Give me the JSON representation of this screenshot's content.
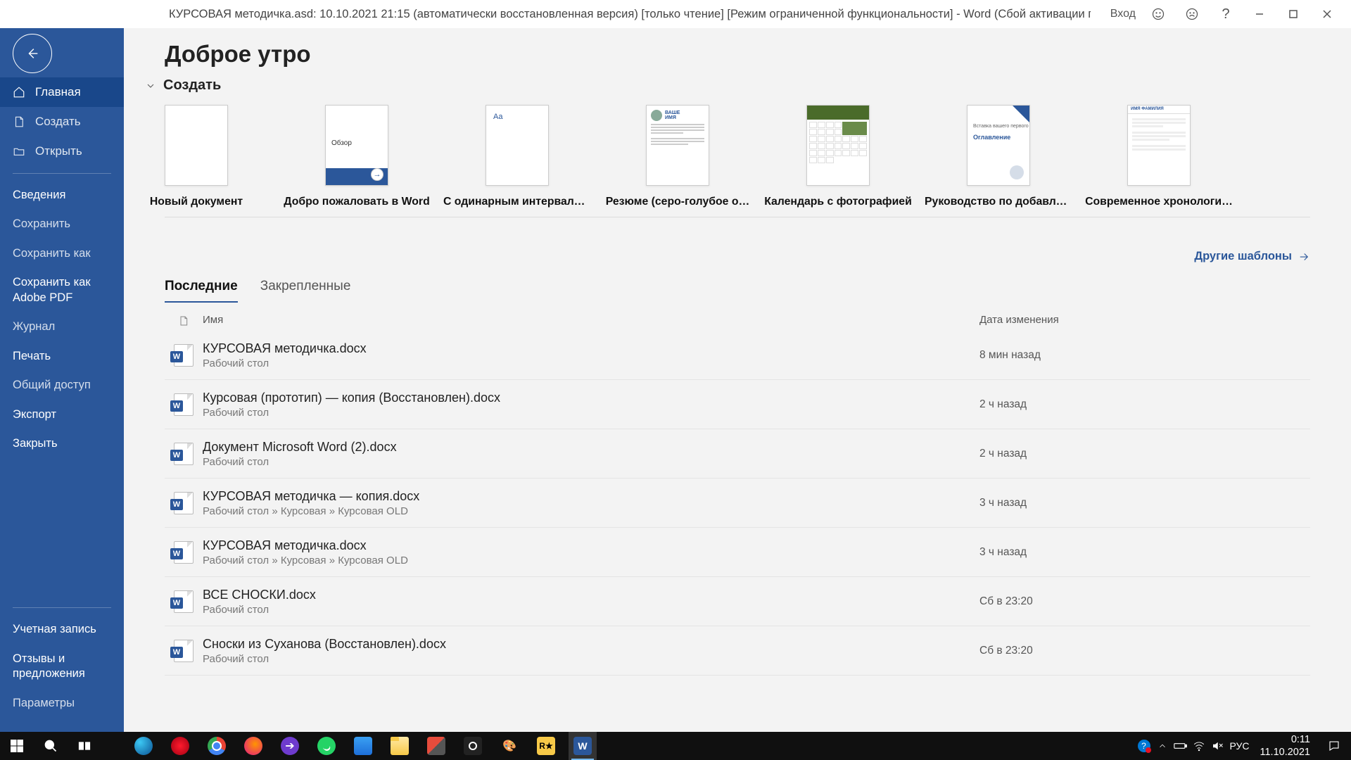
{
  "titlebar": {
    "text": "КУРСОВАЯ методичка.asd: 10.10.2021 21:15 (автоматически восстановленная версия) [только чтение] [Режим ограниченной функциональности]  -  Word (Сбой активации продукта)",
    "login": "Вход"
  },
  "sidebar": {
    "home": "Главная",
    "create": "Создать",
    "open": "Открыть",
    "info": "Сведения",
    "save": "Сохранить",
    "save_as": "Сохранить как",
    "save_pdf": "Сохранить как Adobe PDF",
    "history": "Журнал",
    "print": "Печать",
    "share": "Общий доступ",
    "export": "Экспорт",
    "close": "Закрыть",
    "account": "Учетная запись",
    "feedback": "Отзывы и предложения",
    "options": "Параметры"
  },
  "main": {
    "greeting": "Доброе утро",
    "create_section": "Создать",
    "templates": [
      {
        "label": "Новый документ"
      },
      {
        "label": "Добро пожаловать в Word"
      },
      {
        "label": "С одинарным интервало…"
      },
      {
        "label": "Резюме (серо-голубое о…"
      },
      {
        "label": "Календарь с фотографией"
      },
      {
        "label": "Руководство по добавле…"
      },
      {
        "label": "Современное хронологи…"
      }
    ],
    "tour_text": "Обзор",
    "guide_t1": "Вставка вашего первого",
    "guide_t2": "Оглавление",
    "more_templates": "Другие шаблоны",
    "tabs": {
      "recent": "Последние",
      "pinned": "Закрепленные"
    },
    "col_name": "Имя",
    "col_date": "Дата изменения",
    "files": [
      {
        "name": "КУРСОВАЯ методичка.docx",
        "path": "Рабочий стол",
        "date": "8 мин назад"
      },
      {
        "name": "Курсовая (прототип) — копия (Восстановлен).docx",
        "path": "Рабочий стол",
        "date": "2 ч назад"
      },
      {
        "name": "Документ Microsoft Word (2).docx",
        "path": "Рабочий стол",
        "date": "2 ч назад"
      },
      {
        "name": "КУРСОВАЯ методичка — копия.docx",
        "path": "Рабочий стол » Курсовая » Курсовая OLD",
        "date": "3 ч назад"
      },
      {
        "name": "КУРСОВАЯ методичка.docx",
        "path": "Рабочий стол » Курсовая » Курсовая OLD",
        "date": "3 ч назад"
      },
      {
        "name": "ВСЕ СНОСКИ.docx",
        "path": "Рабочий стол",
        "date": "Сб в 23:20"
      },
      {
        "name": "Сноски из Суханова (Восстановлен).docx",
        "path": "Рабочий стол",
        "date": "Сб в 23:20"
      }
    ]
  },
  "taskbar": {
    "lang": "РУС",
    "time": "0:11",
    "date": "11.10.2021"
  }
}
